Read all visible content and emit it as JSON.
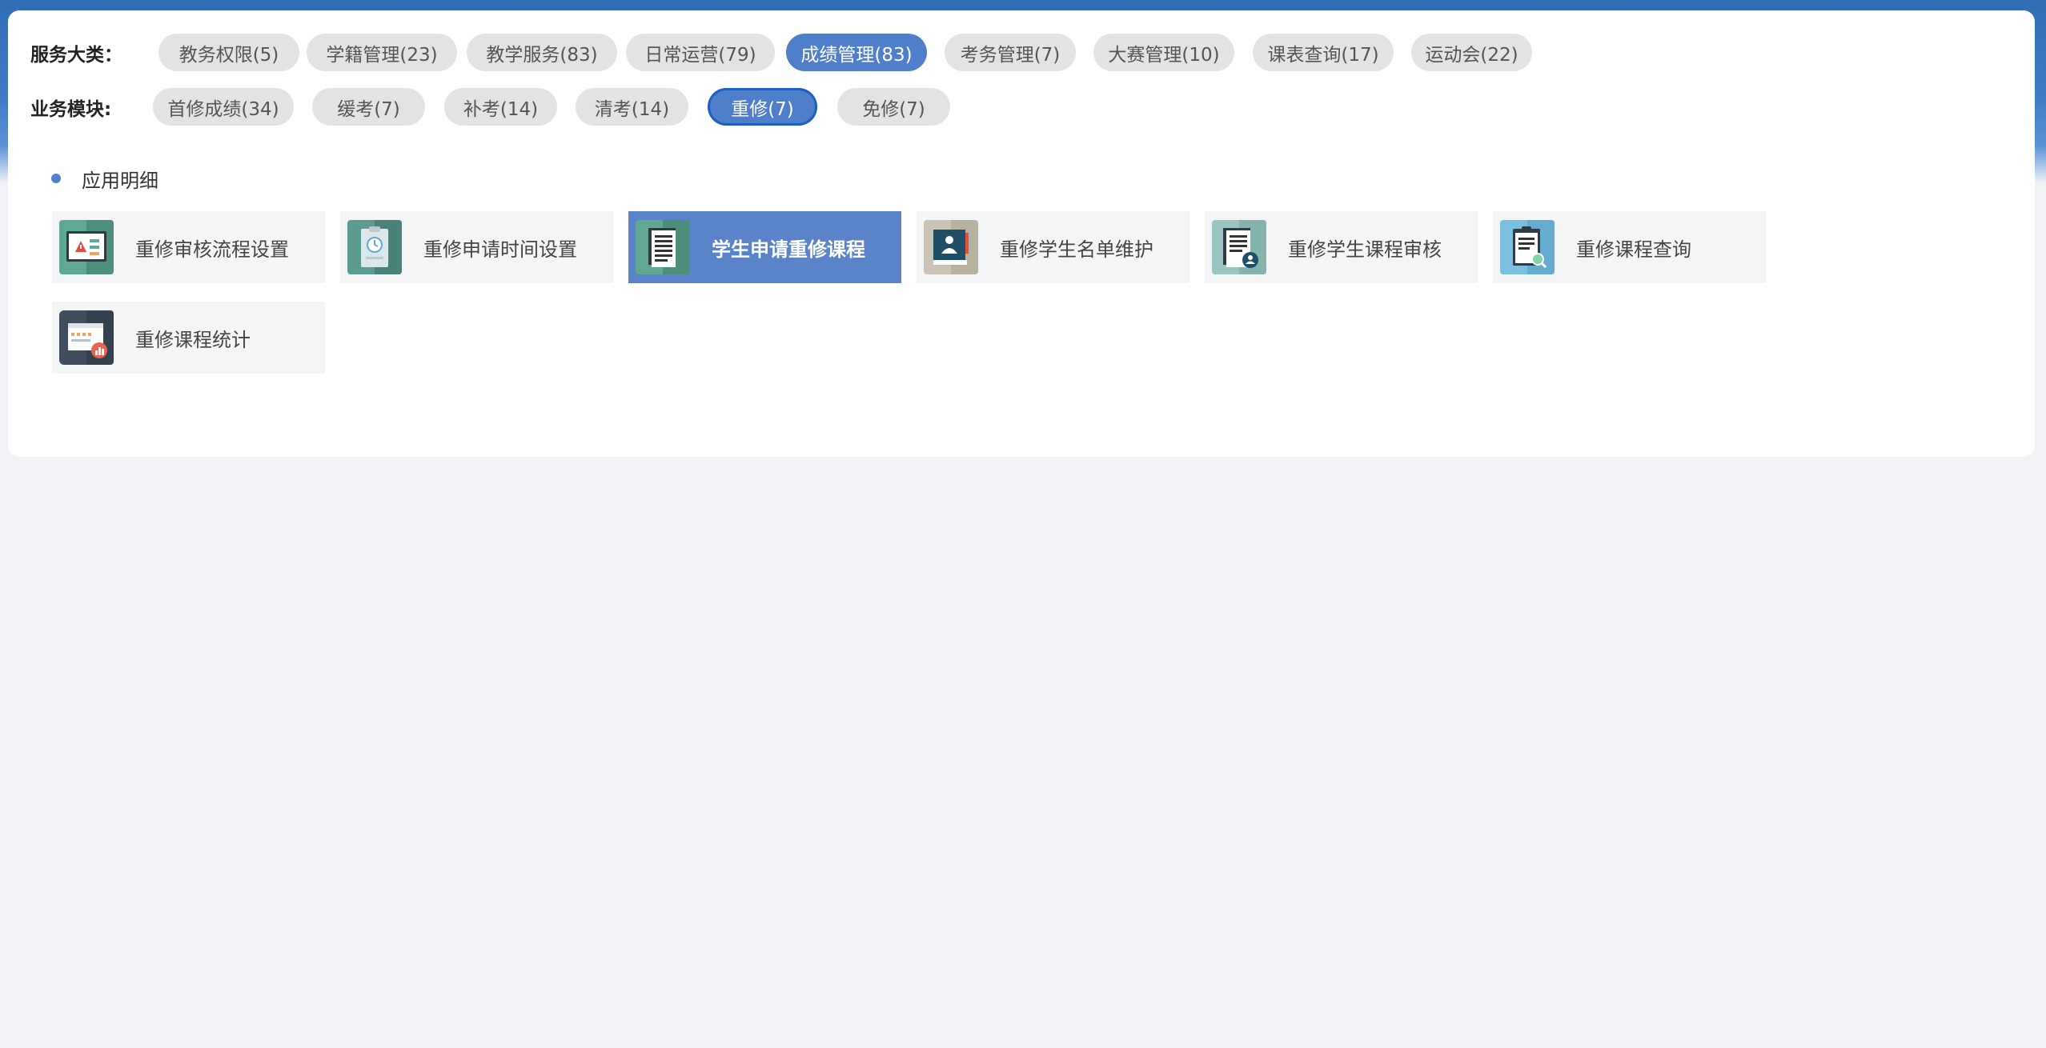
{
  "category_row": {
    "label": "服务大类：",
    "items": [
      {
        "label": "教务权限(5)",
        "active": false
      },
      {
        "label": "学籍管理(23)",
        "active": false
      },
      {
        "label": "教学服务(83)",
        "active": false
      },
      {
        "label": "日常运营(79)",
        "active": false
      },
      {
        "label": "成绩管理(83)",
        "active": true
      },
      {
        "label": "考务管理(7)",
        "active": false
      },
      {
        "label": "大赛管理(10)",
        "active": false
      },
      {
        "label": "课表查询(17)",
        "active": false
      },
      {
        "label": "运动会(22)",
        "active": false
      }
    ]
  },
  "module_row": {
    "label": "业务模块:",
    "items": [
      {
        "label": "首修成绩(34)",
        "active": false
      },
      {
        "label": "缓考(7)",
        "active": false
      },
      {
        "label": "补考(14)",
        "active": false
      },
      {
        "label": "清考(14)",
        "active": false
      },
      {
        "label": "重修(7)",
        "active": true
      },
      {
        "label": "免修(7)",
        "active": false
      }
    ]
  },
  "app_section": {
    "title": "应用明细",
    "apps": [
      {
        "label": "重修审核流程设置",
        "icon": "warning-review-icon",
        "active": false
      },
      {
        "label": "重修申请时间设置",
        "icon": "clipboard-clock-icon",
        "active": false
      },
      {
        "label": "学生申请重修课程",
        "icon": "document-icon",
        "active": true
      },
      {
        "label": "重修学生名单维护",
        "icon": "student-book-icon",
        "active": false
      },
      {
        "label": "重修学生课程审核",
        "icon": "document-user-icon",
        "active": false
      },
      {
        "label": "重修课程查询",
        "icon": "clipboard-search-icon",
        "active": false
      },
      {
        "label": "重修课程统计",
        "icon": "chart-board-icon",
        "active": false
      }
    ]
  },
  "colors": {
    "accent": "#4f7ecb",
    "header": "#2f6db5",
    "chip_bg": "#e3e3e3"
  }
}
